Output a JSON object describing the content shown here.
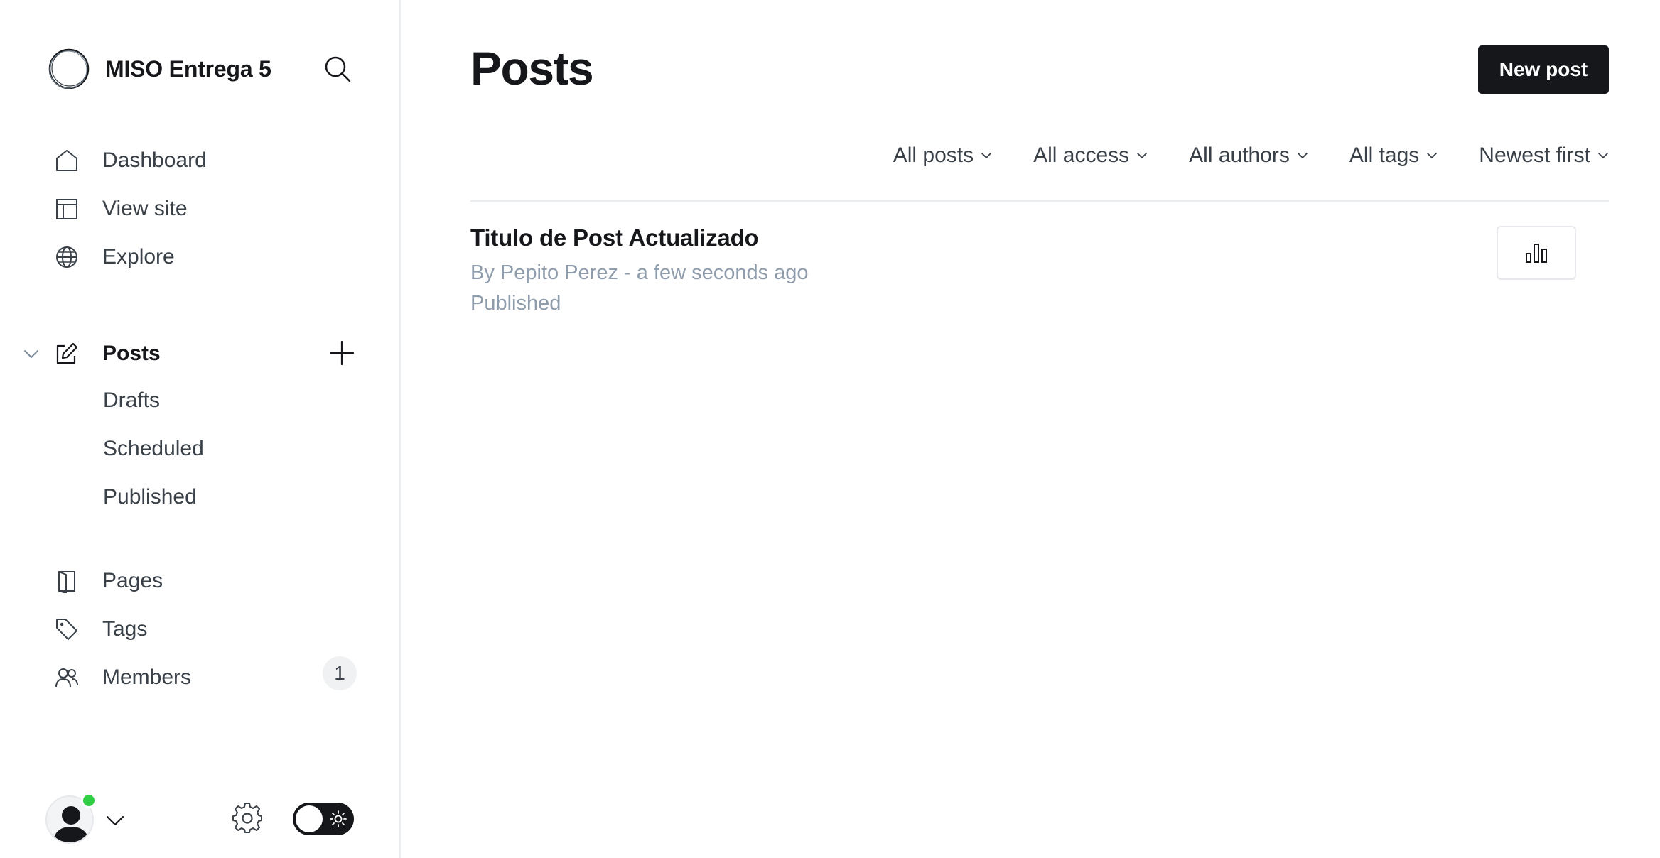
{
  "site": {
    "name": "MISO Entrega 5"
  },
  "nav": {
    "dashboard": "Dashboard",
    "view_site": "View site",
    "explore": "Explore",
    "posts": "Posts",
    "drafts": "Drafts",
    "scheduled": "Scheduled",
    "published": "Published",
    "pages": "Pages",
    "tags": "Tags",
    "members": "Members",
    "members_count": "1"
  },
  "main": {
    "title": "Posts",
    "new_post_label": "New post",
    "filters": [
      "All posts",
      "All access",
      "All authors",
      "All tags",
      "Newest first"
    ]
  },
  "posts": [
    {
      "title": "Titulo de Post Actualizado",
      "meta": "By Pepito Perez - a few seconds ago",
      "status": "Published"
    }
  ],
  "colors": {
    "accent": "#15171a",
    "online": "#30cf43",
    "muted_text": "#8e9cac"
  },
  "icons": {
    "search": "search-icon",
    "home": "home-icon",
    "view_site": "layout-icon",
    "explore": "globe-icon",
    "posts": "edit-icon",
    "pages": "page-icon",
    "tags": "tag-icon",
    "members": "members-icon",
    "settings": "gear-icon",
    "stats": "bar-chart-icon"
  }
}
